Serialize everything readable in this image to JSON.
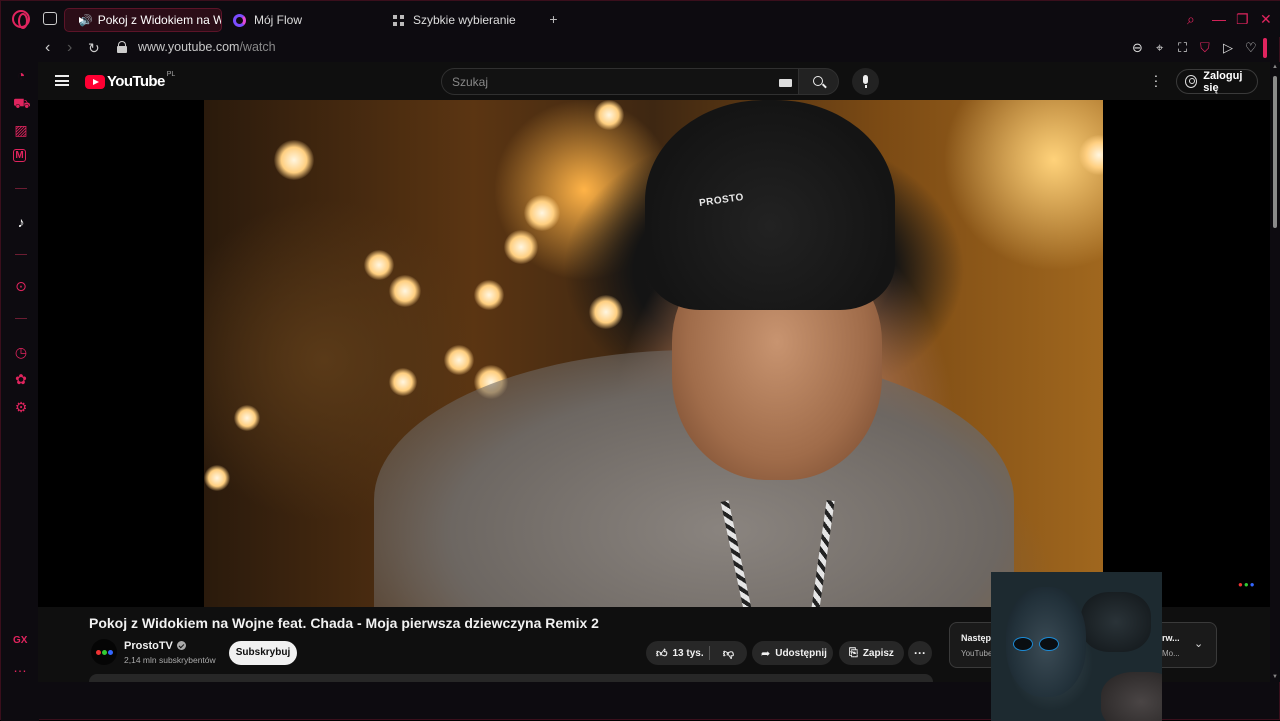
{
  "browser": {
    "tabs": [
      {
        "label": "Pokoj z Widokiem na W",
        "active": true,
        "icon": "youtube-icon"
      },
      {
        "label": "Mój Flow",
        "active": false,
        "icon": "flow-icon"
      },
      {
        "label": "Szybkie wybieranie",
        "active": false,
        "icon": "grid-icon"
      }
    ],
    "new_tab": "+",
    "url_host": "www.youtube.com",
    "url_path": "/watch",
    "accent_color": "#e0245e"
  },
  "sidebar": {
    "icons": [
      "gx-control-icon",
      "aria-icon",
      "twitch-icon",
      "messenger-icon",
      "tiktok-icon",
      "player-icon",
      "history-icon",
      "extensions-icon",
      "settings-icon"
    ],
    "gx_label": "GX",
    "more_label": "…"
  },
  "youtube": {
    "logo_text": "YouTube",
    "country_code": "PL",
    "search_placeholder": "Szukaj",
    "signin_label": "Zaloguj się",
    "video_overlay_text": "PROSTO"
  },
  "video": {
    "title": "Pokoj z Widokiem na Wojne feat. Chada - Moja pierwsza dziewczyna Remix 2",
    "channel_name": "ProstoTV",
    "subscribers": "2,14 mln subskrybentów",
    "subscribe_label": "Subskrybuj",
    "likes": "13 tys.",
    "share_label": "Udostępnij",
    "save_label": "Zapisz",
    "more_label": "···"
  },
  "next_card": {
    "label": "Następ",
    "source": "YouTube",
    "title": "rw...",
    "subtitle": "Mo..."
  }
}
